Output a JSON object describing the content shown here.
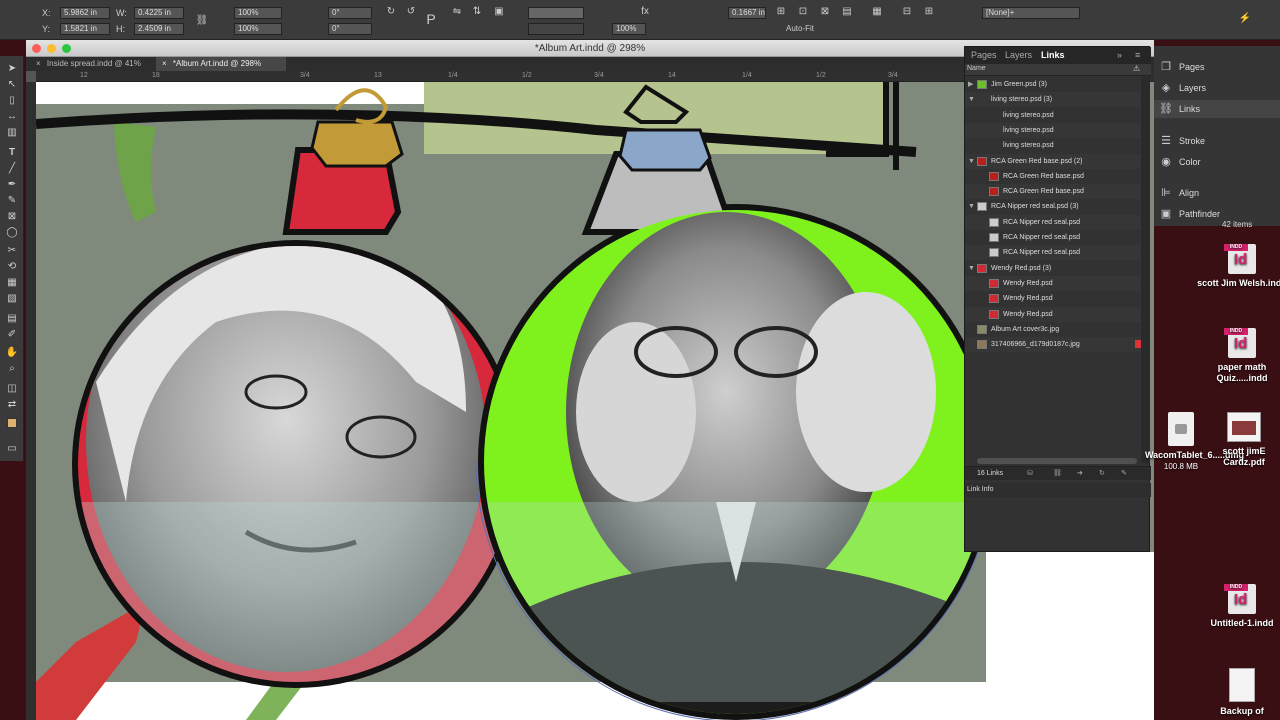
{
  "controlbar": {
    "x_label": "X:",
    "x_value": "5.9862 in",
    "y_label": "Y:",
    "y_value": "1.5821 in",
    "w_label": "W:",
    "w_value": "0.4225 in",
    "h_label": "H:",
    "h_value": "2.4509 in",
    "scale_x": "100%",
    "scale_y": "100%",
    "rotate": "0°",
    "shear": "0°",
    "stroke_weight": "0.1667 in",
    "opacity": "100%",
    "autofit_label": "Auto-Fit",
    "style_value": "[None]+"
  },
  "window": {
    "title": "*Album Art.indd @ 298%",
    "tabs": [
      {
        "label": "Inside spread.indd @ 41%"
      },
      {
        "label": "*Album Art.indd @ 298%"
      }
    ]
  },
  "ruler_ticks": [
    "12",
    "18",
    "3/4",
    "13",
    "1/4",
    "1/2",
    "3/4",
    "14",
    "1/4",
    "1/2",
    "3/4"
  ],
  "links_panel": {
    "tabs": [
      "Pages",
      "Layers",
      "Links"
    ],
    "column_header": "Name",
    "rows": [
      {
        "name": "Jim Green.psd (3)",
        "level": 0,
        "arrow": "▶",
        "thumb_color": "#6bbf2b"
      },
      {
        "name": "living stereo.psd (3)",
        "level": 0,
        "arrow": "▼",
        "thumb_color": ""
      },
      {
        "name": "living stereo.psd",
        "level": 1,
        "arrow": "",
        "thumb_color": ""
      },
      {
        "name": "living stereo.psd",
        "level": 1,
        "arrow": "",
        "thumb_color": ""
      },
      {
        "name": "living stereo.psd",
        "level": 1,
        "arrow": "",
        "thumb_color": ""
      },
      {
        "name": "RCA Green Red base.psd (2)",
        "level": 0,
        "arrow": "▼",
        "thumb_color": "#b82020"
      },
      {
        "name": "RCA Green Red base.psd",
        "level": 1,
        "arrow": "",
        "thumb_color": "#b82020"
      },
      {
        "name": "RCA Green Red base.psd",
        "level": 1,
        "arrow": "",
        "thumb_color": "#b82020"
      },
      {
        "name": "RCA Nipper red seal.psd (3)",
        "level": 0,
        "arrow": "▼",
        "thumb_color": "#cccccc"
      },
      {
        "name": "RCA Nipper red seal.psd",
        "level": 1,
        "arrow": "",
        "thumb_color": "#cccccc"
      },
      {
        "name": "RCA Nipper red seal.psd",
        "level": 1,
        "arrow": "",
        "thumb_color": "#cccccc"
      },
      {
        "name": "RCA Nipper red seal.psd",
        "level": 1,
        "arrow": "",
        "thumb_color": "#cccccc"
      },
      {
        "name": "Wendy Red.psd (3)",
        "level": 0,
        "arrow": "▼",
        "thumb_color": "#d02a35"
      },
      {
        "name": "Wendy Red.psd",
        "level": 1,
        "arrow": "",
        "thumb_color": "#d02a35"
      },
      {
        "name": "Wendy Red.psd",
        "level": 1,
        "arrow": "",
        "thumb_color": "#d02a35"
      },
      {
        "name": "Wendy Red.psd",
        "level": 1,
        "arrow": "",
        "thumb_color": "#d02a35"
      },
      {
        "name": "Album Art cover3c.jpg",
        "level": 0,
        "arrow": "",
        "thumb_color": "#8a8a6a"
      },
      {
        "name": "317406966_d179d0187c.jpg",
        "level": 0,
        "arrow": "",
        "thumb_color": "#8a7a5a"
      }
    ],
    "footer_count": "16 Links",
    "info_label": "Link Info"
  },
  "dock": [
    {
      "label": "Pages",
      "icon": "pages-icon",
      "glyph": "❐"
    },
    {
      "label": "Layers",
      "icon": "layers-icon",
      "glyph": "◈"
    },
    {
      "label": "Links",
      "icon": "links-icon",
      "glyph": "⛓"
    },
    {
      "label": "Stroke",
      "icon": "stroke-icon",
      "glyph": "☰"
    },
    {
      "label": "Color",
      "icon": "color-icon",
      "glyph": "◉"
    },
    {
      "label": "Align",
      "icon": "align-icon",
      "glyph": "⊫"
    },
    {
      "label": "Pathfinder",
      "icon": "pathfinder-icon",
      "glyph": "▣"
    }
  ],
  "desktop": {
    "items_count_text": "42 items",
    "icons": [
      {
        "label": "scott Jim Welsh.indd",
        "type": "indd"
      },
      {
        "label": "paper math Quiz.....indd",
        "type": "indd"
      },
      {
        "label": "WacomTablet_6.....dmg",
        "sub": "100.8 MB",
        "type": "dmg"
      },
      {
        "label": "scott jimE Cardz.pdf",
        "type": "pdf"
      },
      {
        "label": "Untitled-1.indd",
        "type": "indd"
      },
      {
        "label": "Backup of",
        "type": "doc"
      }
    ],
    "indd_badge": "INDD",
    "indd_glyph": "Id"
  }
}
